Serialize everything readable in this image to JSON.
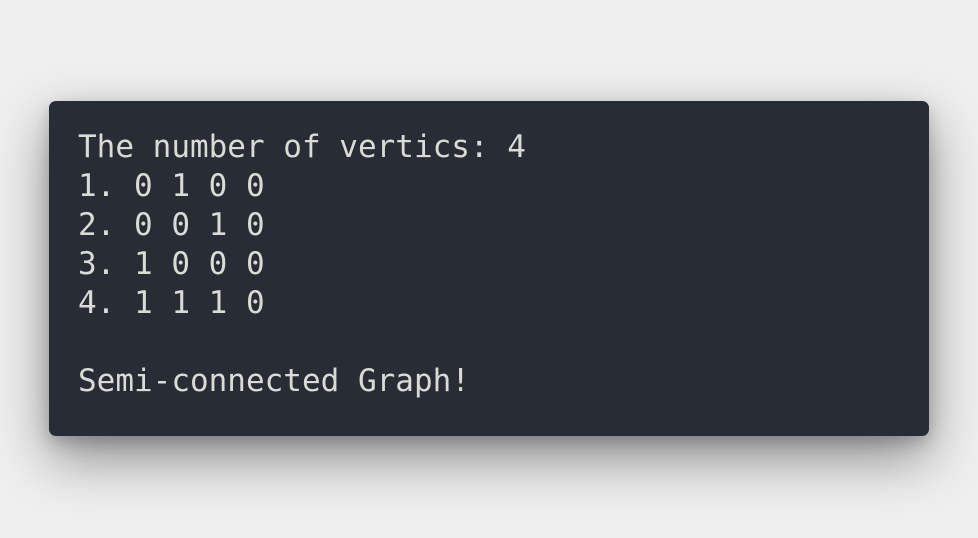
{
  "terminal": {
    "lines": [
      "The number of vertics: 4",
      "1. 0 1 0 0",
      "2. 0 0 1 0",
      "3. 1 0 0 0",
      "4. 1 1 1 0",
      "",
      "Semi-connected Graph!"
    ],
    "colors": {
      "background": "#282c34",
      "text": "#d8dbd6",
      "page": "#efefef"
    }
  }
}
